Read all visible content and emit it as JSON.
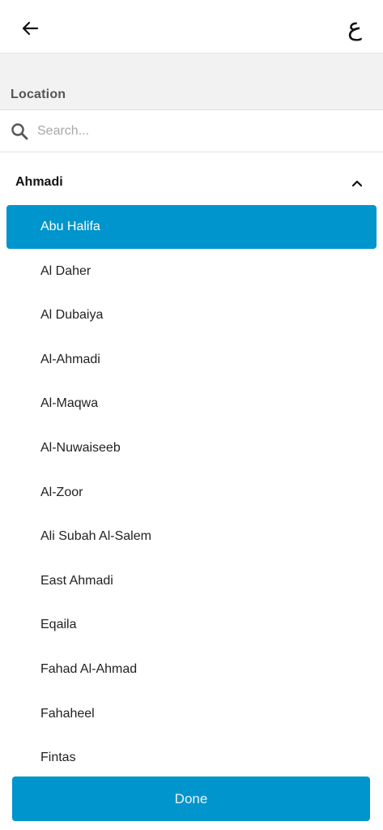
{
  "header": {
    "back_icon": "arrow-left-icon",
    "language_label": "ع"
  },
  "section": {
    "title": "Location"
  },
  "search": {
    "icon": "search-icon",
    "placeholder": "Search...",
    "value": ""
  },
  "group": {
    "title": "Ahmadi",
    "expanded": true,
    "chevron_icon": "chevron-up-icon",
    "items": [
      {
        "label": "Abu Halifa",
        "selected": true
      },
      {
        "label": "Al Daher",
        "selected": false
      },
      {
        "label": "Al Dubaiya",
        "selected": false
      },
      {
        "label": "Al-Ahmadi",
        "selected": false
      },
      {
        "label": "Al-Maqwa",
        "selected": false
      },
      {
        "label": "Al-Nuwaiseeb",
        "selected": false
      },
      {
        "label": "Al-Zoor",
        "selected": false
      },
      {
        "label": "Ali Subah Al-Salem",
        "selected": false
      },
      {
        "label": "East Ahmadi",
        "selected": false
      },
      {
        "label": "Eqaila",
        "selected": false
      },
      {
        "label": "Fahad Al-Ahmad",
        "selected": false
      },
      {
        "label": "Fahaheel",
        "selected": false
      },
      {
        "label": "Fintas",
        "selected": false
      }
    ]
  },
  "footer": {
    "done_label": "Done"
  },
  "colors": {
    "accent": "#0095cc",
    "section_bg": "#f2f2f2"
  }
}
